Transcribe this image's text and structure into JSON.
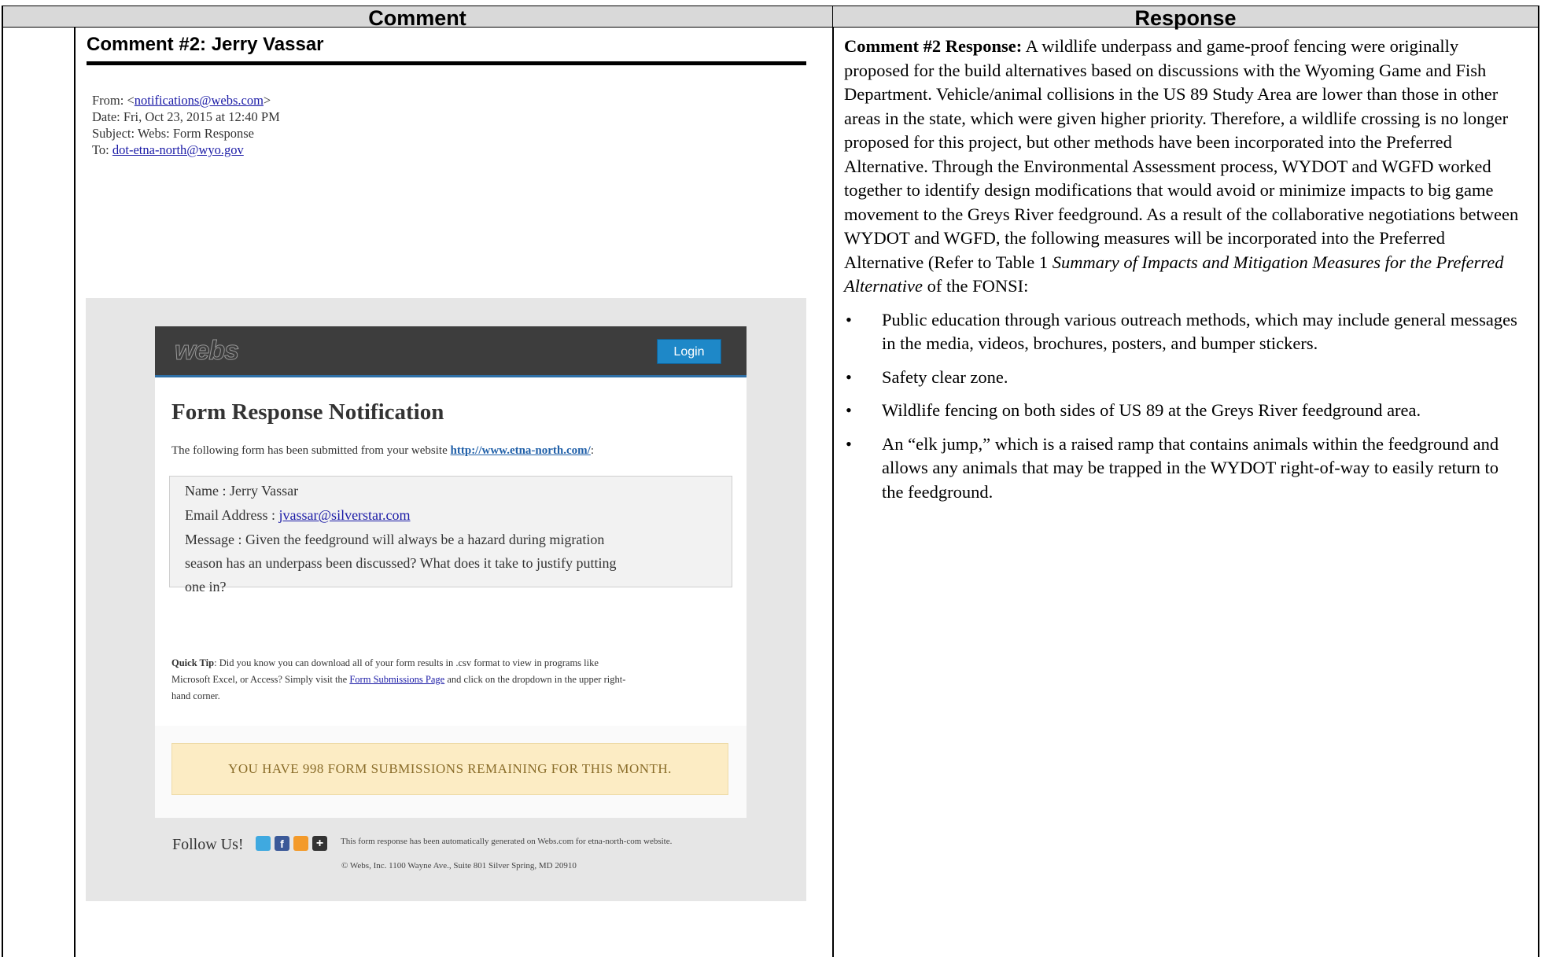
{
  "table": {
    "header_left": "Comment",
    "header_right": "Response"
  },
  "comment": {
    "title": "Comment #2:  Jerry Vassar",
    "email_header": {
      "from_label": "From: <",
      "from_email": "notifications@webs.com",
      "from_close": ">",
      "date": "Date: Fri, Oct 23, 2015 at 12:40 PM",
      "subject": "Subject: Webs: Form Response",
      "to_label": "To: ",
      "to_email": "dot-etna-north@wyo.gov"
    },
    "email_body": {
      "logo": "webs",
      "login_label": "Login",
      "heading": "Form Response Notification",
      "intro": "The following form has been submitted from your website ",
      "intro_link": "http://www.etna-north.com/",
      "intro_end": ":",
      "name_line": "Name : Jerry Vassar",
      "email_label": "Email Address : ",
      "email_value": "jvassar@silverstar.com",
      "message_line1": "Message : Given the feedground will always be a hazard during migration",
      "message_line2": "season has an underpass been discussed? What does it take to justify putting",
      "message_line3": "one in?",
      "quick_tip_label": "Quick Tip",
      "quick_tip_text1": ": Did you know you can download all of your form results in .csv format to view in programs like",
      "quick_tip_text2": "Microsoft Excel, or Access? Simply visit the ",
      "quick_tip_link": "Form Submissions Page",
      "quick_tip_text3": " and click on the dropdown in the upper right-",
      "quick_tip_text4": "hand corner.",
      "remaining": "YOU HAVE 998 FORM SUBMISSIONS REMAINING FOR THIS MONTH.",
      "follow_label": "Follow Us!",
      "social_icons": [
        "twitter-icon",
        "facebook-icon",
        "rss-icon",
        "plus-icon"
      ],
      "footer_line1": "This form response has been automatically generated on Webs.com for etna-north-com website.",
      "footer_line2": "© Webs, Inc. 1100 Wayne Ave., Suite 801 Silver Spring, MD 20910",
      "colors": {
        "bar": "#3d3d3d",
        "login": "#1e88c8",
        "remaining_bg": "#fcecc4"
      }
    }
  },
  "response": {
    "lead_bold": "Comment #2 Response:",
    "para1": "  A wildlife underpass and game-proof fencing were originally proposed for the build alternatives based on discussions with the Wyoming Game and Fish Department. Vehicle/animal collisions in the US 89 Study Area are lower than those in other areas in the state, which were given higher priority. Therefore, a wildlife crossing is no longer proposed for this project, but other methods have been incorporated into the Preferred Alternative. Through the Environmental Assessment process, WYDOT and WGFD worked together to identify design modifications that would avoid or minimize impacts to big game movement to the Greys River feedground. As a result of the collaborative negotiations between WYDOT and WGFD, the following measures will be incorporated into the Preferred Alternative (Refer to Table 1 ",
    "para1_italic": "Summary of Impacts and Mitigation Measures for the Preferred Alternative",
    "para1_end": " of the FONSI:",
    "bullets": [
      "Public education through various outreach methods, which may include general messages in the media, videos, brochures, posters, and bumper stickers.",
      "Safety clear zone.",
      "Wildlife fencing on both sides of US 89 at the Greys River feedground area.",
      "An “elk jump,” which is a raised ramp that contains animals within the feedground and allows any animals that may be trapped in the WYDOT right-of-way to easily return to the feedground."
    ],
    "bullet_char": "•"
  }
}
